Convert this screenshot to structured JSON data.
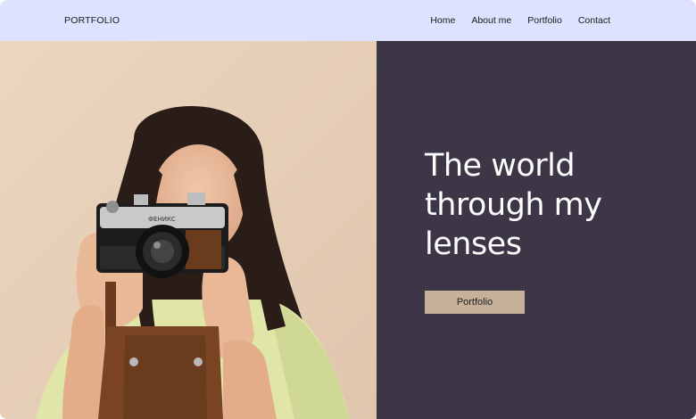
{
  "header": {
    "logo": "PORTFOLIO",
    "nav": [
      {
        "label": "Home"
      },
      {
        "label": "About me"
      },
      {
        "label": "Portfolio"
      },
      {
        "label": "Contact"
      }
    ]
  },
  "hero": {
    "title": "The world through my lenses",
    "button_label": "Portfolio",
    "camera_brand": "ФЕНИКС"
  },
  "colors": {
    "header_bg": "#dde2ff",
    "hero_panel_bg": "#3c3646",
    "button_bg": "#c8b19a",
    "photo_bg": "#e6cfb7"
  }
}
